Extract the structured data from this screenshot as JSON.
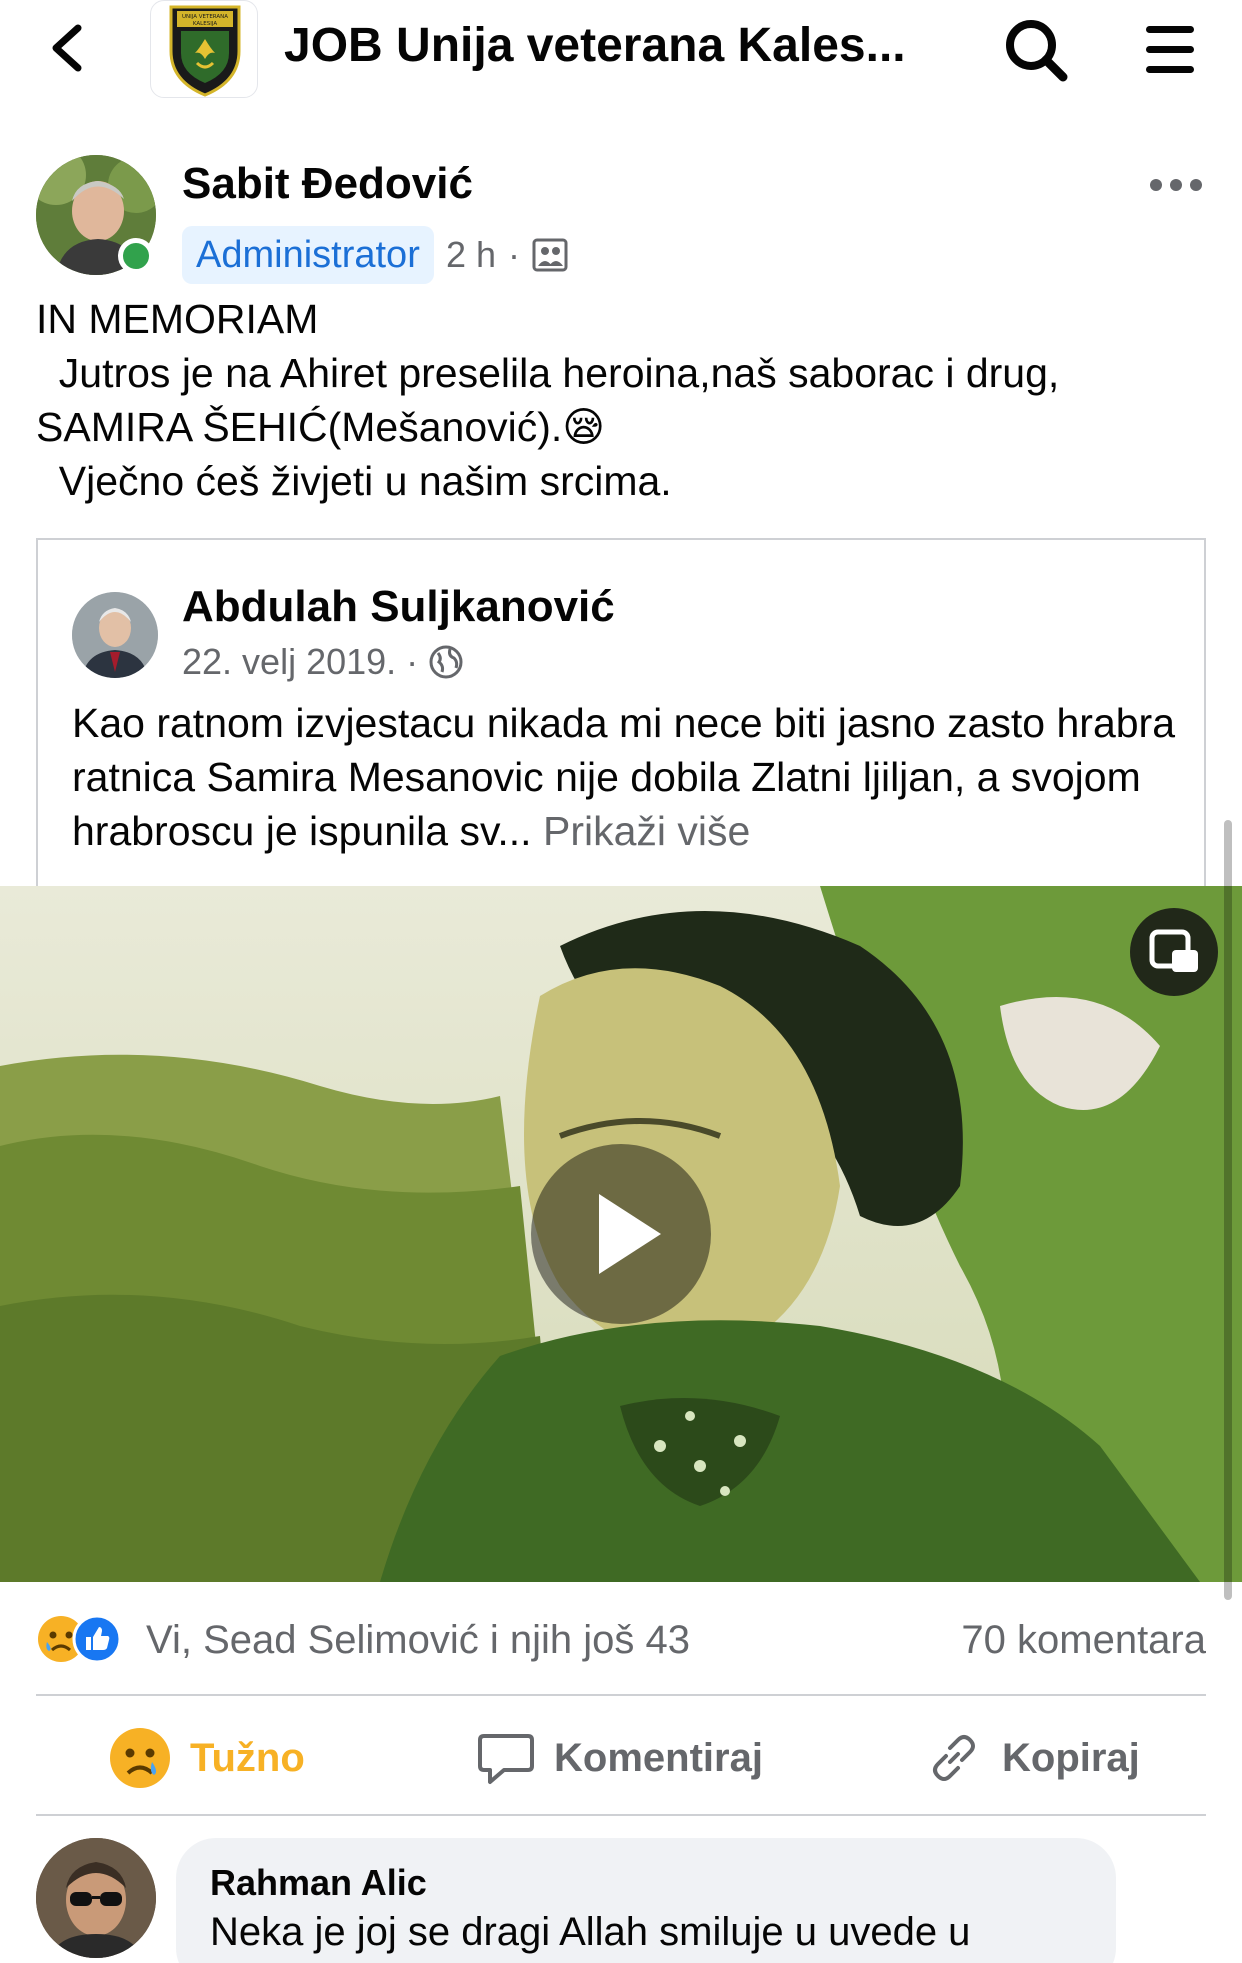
{
  "header": {
    "group_title": "JOB Unija veterana Kales...",
    "logo_text": [
      "UNIJA VETERANA",
      "KALESIJA"
    ]
  },
  "post": {
    "author": "Sabit Đedović",
    "badge": "Administrator",
    "time": "2 h",
    "separator": "·",
    "text_lines": [
      "IN MEMORIAM",
      "  Jutros je na Ahiret preselila heroina,naš saborac i drug,",
      "SAMIRA ŠEHIĆ(Mešanović).",
      "  Vječno ćeš živjeti u našim srcima."
    ],
    "emoji": "😪"
  },
  "shared_post": {
    "author": "Abdulah Suljkanović",
    "date": "22. velj 2019.",
    "separator": "·",
    "text": "Kao ratnom izvjestacu nikada mi nece biti jasno zasto hrabra ratnica Samira Mesanovic nije dobila Zlatni ljiljan, a svojom hrabroscu je ispunila sv...",
    "see_more": "Prikaži više"
  },
  "reactions": {
    "summary": "Vi, Sead Selimović i njih još 43",
    "comments": "70 komentara"
  },
  "actions": {
    "sad_label": "Tužno",
    "comment_label": "Komentiraj",
    "copy_label": "Kopiraj"
  },
  "comment": {
    "author": "Rahman Alic",
    "text": "Neka je joj se dragi Allah smiluje u uvede u"
  },
  "colors": {
    "accent_blue": "#1b6fd6",
    "sad_yellow": "#f7b125",
    "online_green": "#31a24c",
    "secondary_text": "#65676b"
  },
  "icons": [
    "back-icon",
    "search-icon",
    "menu-icon",
    "more-icon",
    "group-visibility-icon",
    "globe-icon",
    "pip-icon",
    "play-icon",
    "sad-reaction-icon",
    "like-reaction-icon",
    "comment-icon",
    "link-icon"
  ]
}
